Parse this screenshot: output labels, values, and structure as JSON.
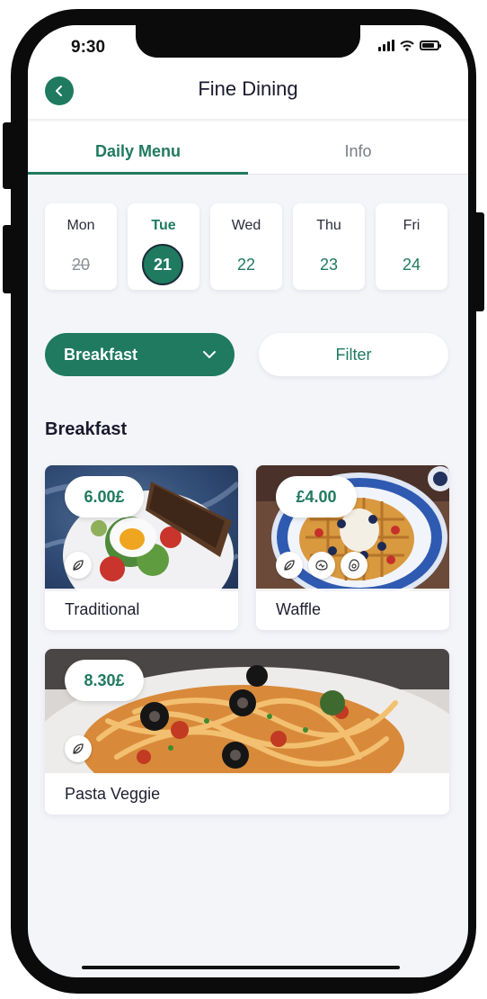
{
  "status_bar": {
    "time": "9:30"
  },
  "header": {
    "title": "Fine Dining",
    "back_icon": "chevron-left-icon"
  },
  "tabs": [
    {
      "label": "Daily Menu",
      "active": true
    },
    {
      "label": "Info",
      "active": false
    }
  ],
  "days": [
    {
      "name": "Mon",
      "date": "20",
      "state": "past"
    },
    {
      "name": "Tue",
      "date": "21",
      "state": "selected"
    },
    {
      "name": "Wed",
      "date": "22",
      "state": "upcoming"
    },
    {
      "name": "Thu",
      "date": "23",
      "state": "upcoming"
    },
    {
      "name": "Fri",
      "date": "24",
      "state": "upcoming"
    }
  ],
  "meal_select": {
    "value": "Breakfast",
    "icon": "chevron-down-icon"
  },
  "filter": {
    "label": "Filter"
  },
  "section": {
    "title": "Breakfast"
  },
  "dishes": [
    {
      "name": "Traditional",
      "price": "6.00£",
      "icons": [
        "vegetarian-leaf-icon"
      ]
    },
    {
      "name": "Waffle",
      "price": "£4.00",
      "icons": [
        "vegetarian-leaf-icon",
        "dairy-icon",
        "egg-icon"
      ]
    },
    {
      "name": "Pasta Veggie",
      "price": "8.30£",
      "icons": [
        "vegetarian-leaf-icon"
      ]
    }
  ],
  "colors": {
    "accent": "#1f7a5f",
    "background": "#f4f5f9",
    "text": "#1a1a2e"
  }
}
